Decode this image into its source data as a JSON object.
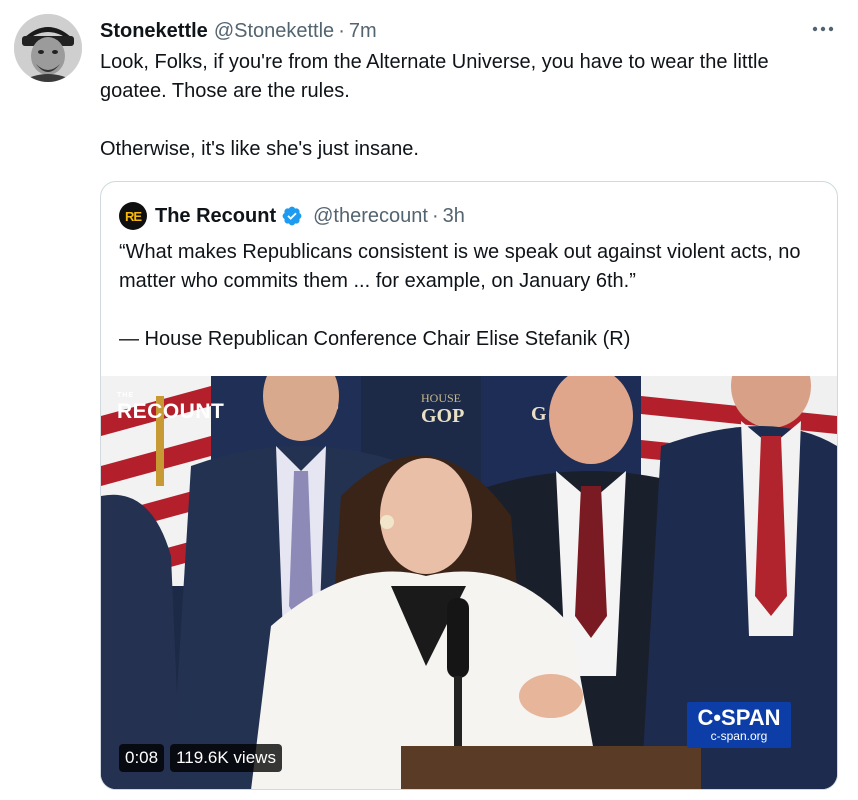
{
  "tweet": {
    "display_name": "Stonekettle",
    "handle": "@Stonekettle",
    "separator": "·",
    "time": "7m",
    "more_icon": "more-horizontal-icon",
    "text_line1": "Look, Folks, if you're from the Alternate Universe, you have to wear the little goatee. Those are the rules.",
    "text_line2": "Otherwise, it's like she's just insane."
  },
  "quoted_tweet": {
    "avatar_text": "RE",
    "display_name": "The Recount",
    "verified_icon": "verified-badge-icon",
    "handle": "@therecount",
    "separator": "·",
    "time": "3h",
    "text_line1": "“What makes Republicans consistent is we speak out against violent acts, no matter who commits them ... for example, on January 6th.”",
    "text_line2": "— House Republican Conference Chair Elise Stefanik (R)",
    "video": {
      "watermark_small": "THE",
      "watermark": "RECOUNT",
      "network_logo": "C•SPAN",
      "network_url": "c-span.org",
      "duration": "0:08",
      "views": "119.6K views",
      "backdrop_text_1": "HOUSE",
      "backdrop_text_2": "GOP"
    }
  },
  "colors": {
    "text_primary": "#0f1419",
    "text_secondary": "#536471",
    "verified_blue": "#1d9bf0",
    "border": "#cfd9de",
    "cspan_blue": "#0d3ea8"
  }
}
